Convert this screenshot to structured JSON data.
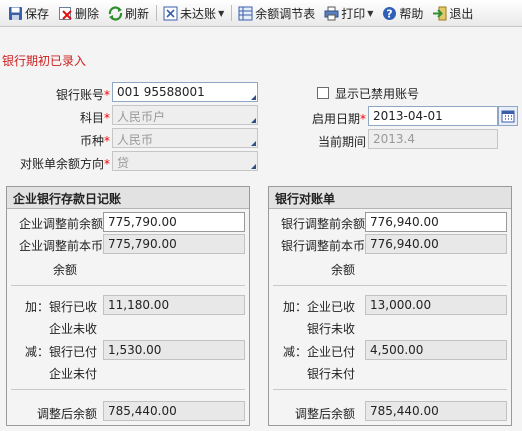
{
  "toolbar": {
    "save": "保存",
    "delete": "删除",
    "refresh": "刷新",
    "unreconciled": "未达账",
    "adjust_table": "余额调节表",
    "print": "打印",
    "help": "帮助",
    "exit": "退出"
  },
  "page_title": "银行期初已录入",
  "form": {
    "bank_account_label": "银行账号",
    "bank_account_value": "001 95588001",
    "subject_label": "科目",
    "subject_value": "人民币户",
    "currency_label": "币种",
    "currency_value": "人民币",
    "direction_label": "对账单余额方向",
    "direction_value": "贷",
    "show_disabled_label": "显示已禁用账号",
    "show_disabled_checked": false,
    "start_date_label": "启用日期",
    "start_date_value": "2013-04-01",
    "current_period_label": "当前期间",
    "current_period_value": "2013.4",
    "required_mark": "*"
  },
  "left_panel": {
    "title": "企业银行存款日记账",
    "before_balance_label": "企业调整前余额",
    "before_balance_value": "775,790.00",
    "before_local_label_1": "企业调整前本币",
    "before_local_label_2": "余额",
    "before_local_value": "775,790.00",
    "add_label": "加：银行已收",
    "add_value": "11,180.00",
    "add_sub_label": "企业未收",
    "less_label": "减：银行已付",
    "less_value": "1,530.00",
    "less_sub_label": "企业未付",
    "adjusted_label": "调整后余额",
    "adjusted_value": "785,440.00"
  },
  "right_panel": {
    "title": "银行对账单",
    "before_balance_label": "银行调整前余额",
    "before_balance_value": "776,940.00",
    "before_local_label_1": "银行调整前本币",
    "before_local_label_2": "余额",
    "before_local_value": "776,940.00",
    "add_label": "加：企业已收",
    "add_value": "13,000.00",
    "add_sub_label": "银行未收",
    "less_label": "减：企业已付",
    "less_value": "4,500.00",
    "less_sub_label": "银行未付",
    "adjusted_label": "调整后余额",
    "adjusted_value": "785,440.00"
  },
  "colors": {
    "title_red": "#cc1f1f",
    "required_red": "#ee0000",
    "input_border": "#8fa6c4"
  },
  "icons": [
    "save-icon",
    "delete-icon",
    "refresh-icon",
    "unreconciled-icon",
    "adjust-table-icon",
    "print-icon",
    "help-icon",
    "exit-icon",
    "calendar-icon"
  ]
}
